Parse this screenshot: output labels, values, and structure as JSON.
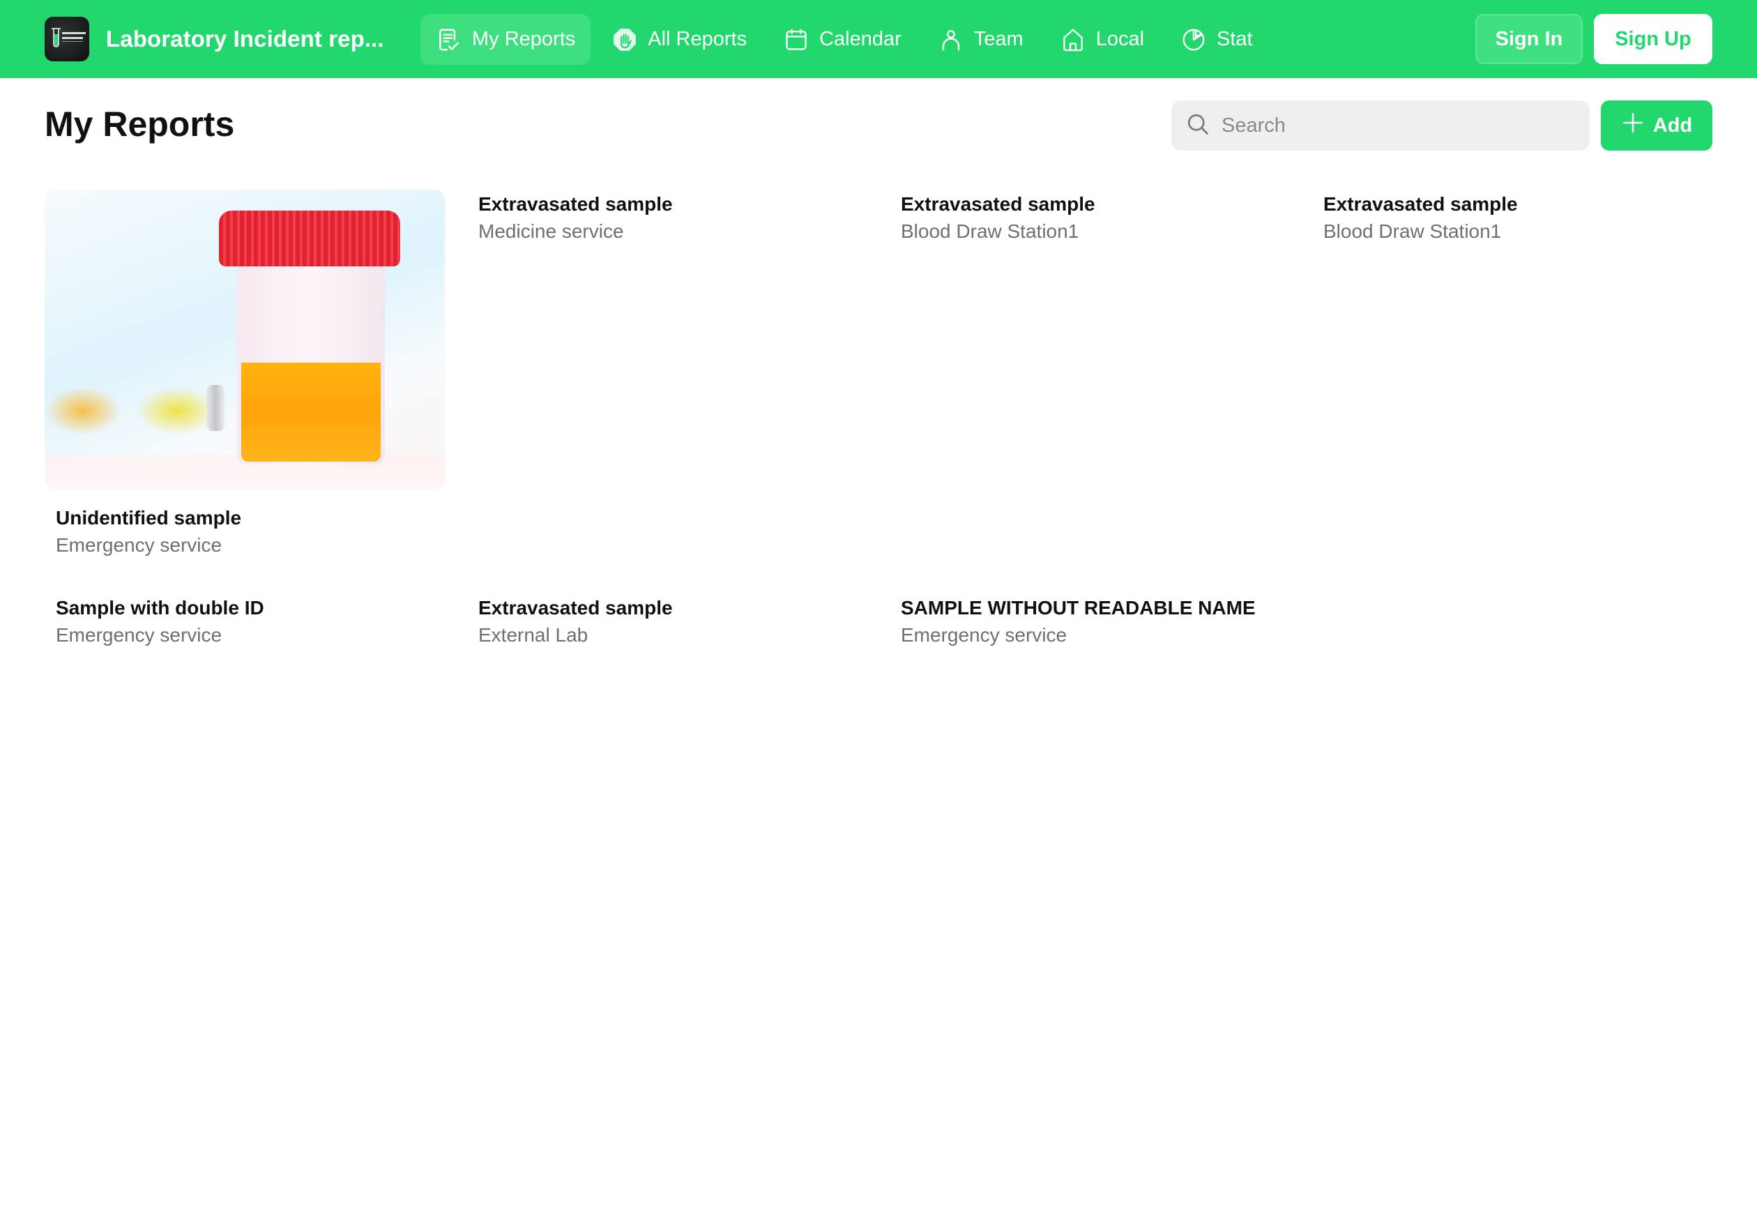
{
  "app": {
    "title": "Laboratory Incident rep...",
    "logo_alt": "Laboratory Incident logo"
  },
  "nav": {
    "items": [
      {
        "label": "My Reports",
        "icon": "report-check-icon",
        "active": true
      },
      {
        "label": "All Reports",
        "icon": "stop-hand-icon",
        "active": false
      },
      {
        "label": "Calendar",
        "icon": "calendar-icon",
        "active": false
      },
      {
        "label": "Team",
        "icon": "user-icon",
        "active": false
      },
      {
        "label": "Local",
        "icon": "home-icon",
        "active": false
      },
      {
        "label": "Stat",
        "icon": "pie-chart-icon",
        "active": false
      }
    ],
    "sign_in": "Sign In",
    "sign_up": "Sign Up"
  },
  "page": {
    "title": "My Reports",
    "search": {
      "placeholder": "Search",
      "value": ""
    },
    "add_label": "Add"
  },
  "reports": [
    {
      "title": "Unidentified sample",
      "subtitle": "Emergency service",
      "has_image": true,
      "image_desc": "urine sample container with red cap"
    },
    {
      "title": "Extravasated sample",
      "subtitle": "Medicine service",
      "has_image": false
    },
    {
      "title": "Extravasated sample",
      "subtitle": "Blood Draw Station1",
      "has_image": false
    },
    {
      "title": "Extravasated sample",
      "subtitle": "Blood Draw Station1",
      "has_image": false
    },
    {
      "title": "Sample with double ID",
      "subtitle": "Emergency service",
      "has_image": false
    },
    {
      "title": "Extravasated sample",
      "subtitle": "External Lab",
      "has_image": false
    },
    {
      "title": "SAMPLE WITHOUT READABLE NAME",
      "subtitle": "Emergency service",
      "has_image": false
    }
  ],
  "colors": {
    "brand_green": "#22d86d",
    "active_nav_bg": "#3ddf7f",
    "search_bg": "#efefef",
    "subtitle_gray": "#6f6f6f"
  }
}
